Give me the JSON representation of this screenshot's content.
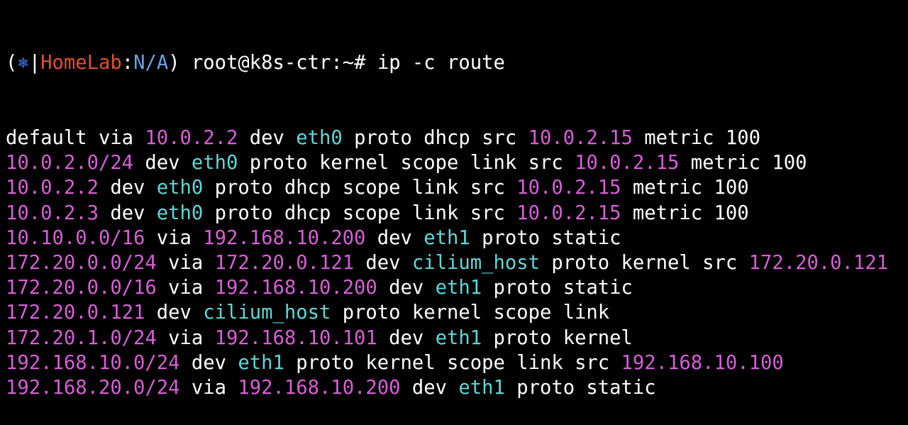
{
  "prompt": {
    "open_paren": "(",
    "k8s_icon": "⎈",
    "separator": "|",
    "context": "HomeLab",
    "colon": ":",
    "namespace": "N/A",
    "close_paren": ")",
    "user_host": " root@k8s-ctr:~# ",
    "command": "ip -c route"
  },
  "colors": {
    "ip_address": "#d75fd7",
    "interface": "#5fd7d7",
    "text": "#ffffff",
    "kube_context": "#e0502e",
    "kube_namespace": "#6aa2e6",
    "background": "#000000"
  },
  "output": [
    [
      {
        "t": "default via ",
        "k": "plain"
      },
      {
        "t": "10.0.2.2",
        "k": "ip"
      },
      {
        "t": " dev ",
        "k": "plain"
      },
      {
        "t": "eth0",
        "k": "dev"
      },
      {
        "t": " proto dhcp src ",
        "k": "plain"
      },
      {
        "t": "10.0.2.15",
        "k": "ip"
      },
      {
        "t": " metric 100",
        "k": "plain"
      }
    ],
    [
      {
        "t": "10.0.2.0/24",
        "k": "ip"
      },
      {
        "t": " dev ",
        "k": "plain"
      },
      {
        "t": "eth0",
        "k": "dev"
      },
      {
        "t": " proto kernel scope link src ",
        "k": "plain"
      },
      {
        "t": "10.0.2.15",
        "k": "ip"
      },
      {
        "t": " metric 100",
        "k": "plain"
      }
    ],
    [
      {
        "t": "10.0.2.2",
        "k": "ip"
      },
      {
        "t": " dev ",
        "k": "plain"
      },
      {
        "t": "eth0",
        "k": "dev"
      },
      {
        "t": " proto dhcp scope link src ",
        "k": "plain"
      },
      {
        "t": "10.0.2.15",
        "k": "ip"
      },
      {
        "t": " metric 100",
        "k": "plain"
      }
    ],
    [
      {
        "t": "10.0.2.3",
        "k": "ip"
      },
      {
        "t": " dev ",
        "k": "plain"
      },
      {
        "t": "eth0",
        "k": "dev"
      },
      {
        "t": " proto dhcp scope link src ",
        "k": "plain"
      },
      {
        "t": "10.0.2.15",
        "k": "ip"
      },
      {
        "t": " metric 100",
        "k": "plain"
      }
    ],
    [
      {
        "t": "10.10.0.0/16",
        "k": "ip"
      },
      {
        "t": " via ",
        "k": "plain"
      },
      {
        "t": "192.168.10.200",
        "k": "ip"
      },
      {
        "t": " dev ",
        "k": "plain"
      },
      {
        "t": "eth1",
        "k": "dev"
      },
      {
        "t": " proto static",
        "k": "plain"
      }
    ],
    [
      {
        "t": "172.20.0.0/24",
        "k": "ip"
      },
      {
        "t": " via ",
        "k": "plain"
      },
      {
        "t": "172.20.0.121",
        "k": "ip"
      },
      {
        "t": " dev ",
        "k": "plain"
      },
      {
        "t": "cilium_host",
        "k": "dev"
      },
      {
        "t": " proto kernel src ",
        "k": "plain"
      },
      {
        "t": "172.20.0.121",
        "k": "ip"
      }
    ],
    [
      {
        "t": "172.20.0.0/16",
        "k": "ip"
      },
      {
        "t": " via ",
        "k": "plain"
      },
      {
        "t": "192.168.10.200",
        "k": "ip"
      },
      {
        "t": " dev ",
        "k": "plain"
      },
      {
        "t": "eth1",
        "k": "dev"
      },
      {
        "t": " proto static",
        "k": "plain"
      }
    ],
    [
      {
        "t": "172.20.0.121",
        "k": "ip"
      },
      {
        "t": " dev ",
        "k": "plain"
      },
      {
        "t": "cilium_host",
        "k": "dev"
      },
      {
        "t": " proto kernel scope link",
        "k": "plain"
      }
    ],
    [
      {
        "t": "172.20.1.0/24",
        "k": "ip"
      },
      {
        "t": " via ",
        "k": "plain"
      },
      {
        "t": "192.168.10.101",
        "k": "ip"
      },
      {
        "t": " dev ",
        "k": "plain"
      },
      {
        "t": "eth1",
        "k": "dev"
      },
      {
        "t": " proto kernel",
        "k": "plain"
      }
    ],
    [
      {
        "t": "192.168.10.0/24",
        "k": "ip"
      },
      {
        "t": " dev ",
        "k": "plain"
      },
      {
        "t": "eth1",
        "k": "dev"
      },
      {
        "t": " proto kernel scope link src ",
        "k": "plain"
      },
      {
        "t": "192.168.10.100",
        "k": "ip"
      }
    ],
    [
      {
        "t": "192.168.20.0/24",
        "k": "ip"
      },
      {
        "t": " via ",
        "k": "plain"
      },
      {
        "t": "192.168.10.200",
        "k": "ip"
      },
      {
        "t": " dev ",
        "k": "plain"
      },
      {
        "t": "eth1",
        "k": "dev"
      },
      {
        "t": " proto static",
        "k": "plain"
      }
    ]
  ]
}
